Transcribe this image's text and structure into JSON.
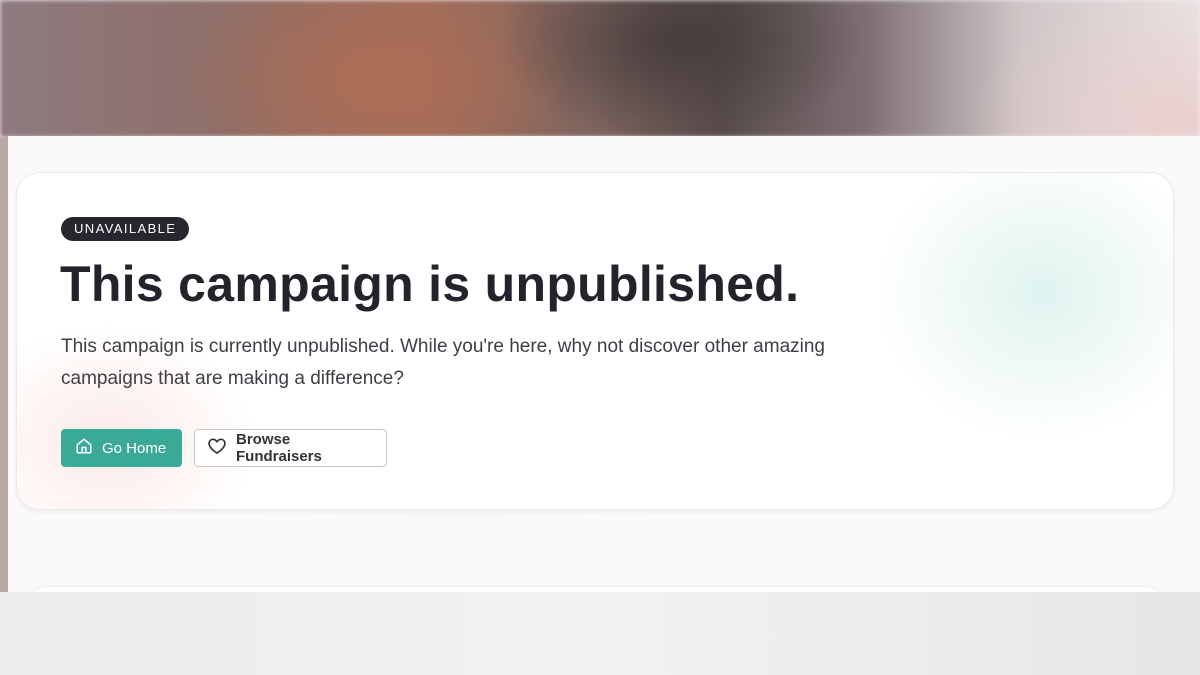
{
  "status_badge": "UNAVAILABLE",
  "heading": "This campaign is unpublished.",
  "description": "This campaign is currently unpublished. While you're here, why not discover other amazing campaigns that are making a difference?",
  "actions": {
    "home": {
      "label": "Go Home",
      "icon": "home-icon"
    },
    "browse": {
      "label": "Browse Fundraisers",
      "icon": "heart-icon"
    }
  },
  "colors": {
    "accent": "#3aaa97",
    "badge_bg": "#27272f",
    "heading": "#23232b"
  }
}
